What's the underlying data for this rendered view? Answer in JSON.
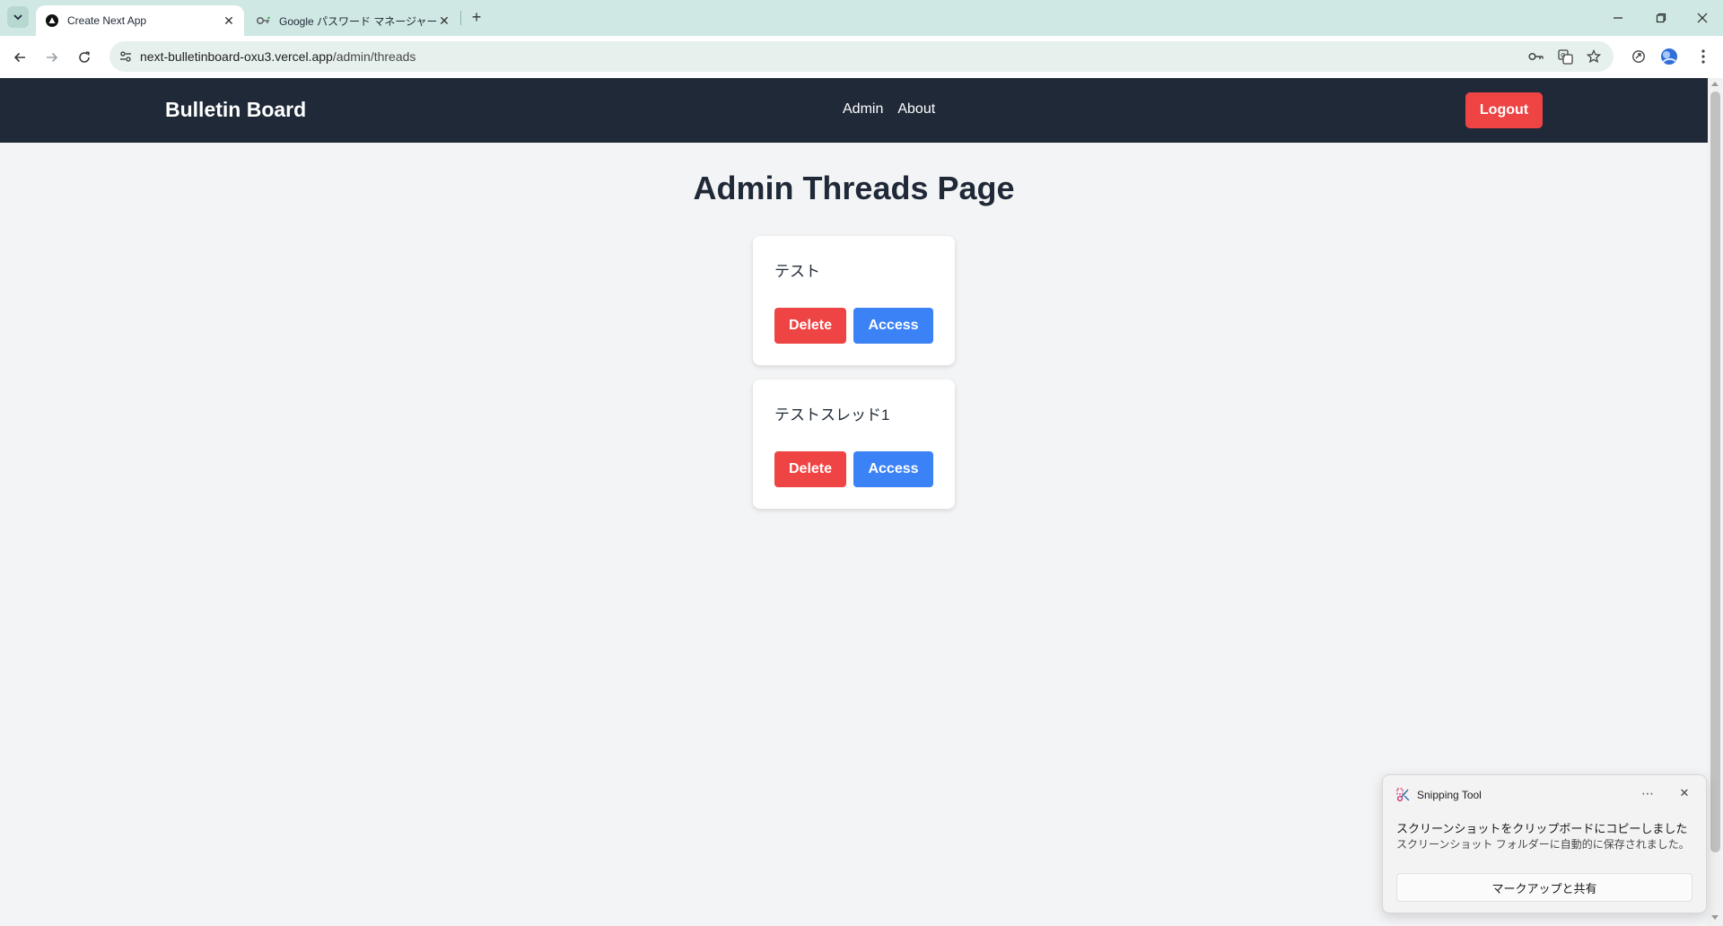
{
  "browser": {
    "tabs": [
      {
        "title": "Create Next App",
        "favicon": "vercel-triangle-icon",
        "active": true
      },
      {
        "title": "Google パスワード マネージャー",
        "favicon": "google-password-key-icon",
        "active": false
      }
    ],
    "url": {
      "host": "next-bulletinboard-oxu3.vercel.app",
      "path": "/admin/threads"
    }
  },
  "header": {
    "brand": "Bulletin Board",
    "nav": [
      "Admin",
      "About"
    ],
    "logout_label": "Logout"
  },
  "main": {
    "title": "Admin Threads Page",
    "threads": [
      {
        "title": "テスト",
        "delete_label": "Delete",
        "access_label": "Access"
      },
      {
        "title": "テストスレッド1",
        "delete_label": "Delete",
        "access_label": "Access"
      }
    ]
  },
  "toast": {
    "app_name": "Snipping Tool",
    "message": "スクリーンショットをクリップボードにコピーしました",
    "detail": "スクリーンショット フォルダーに自動的に保存されました。",
    "action_label": "マークアップと共有"
  },
  "colors": {
    "header_bg": "#1f2937",
    "danger": "#ef4444",
    "primary": "#3b82f6",
    "page_bg": "#f3f4f6",
    "tabbar_bg": "#cfe8e3"
  }
}
